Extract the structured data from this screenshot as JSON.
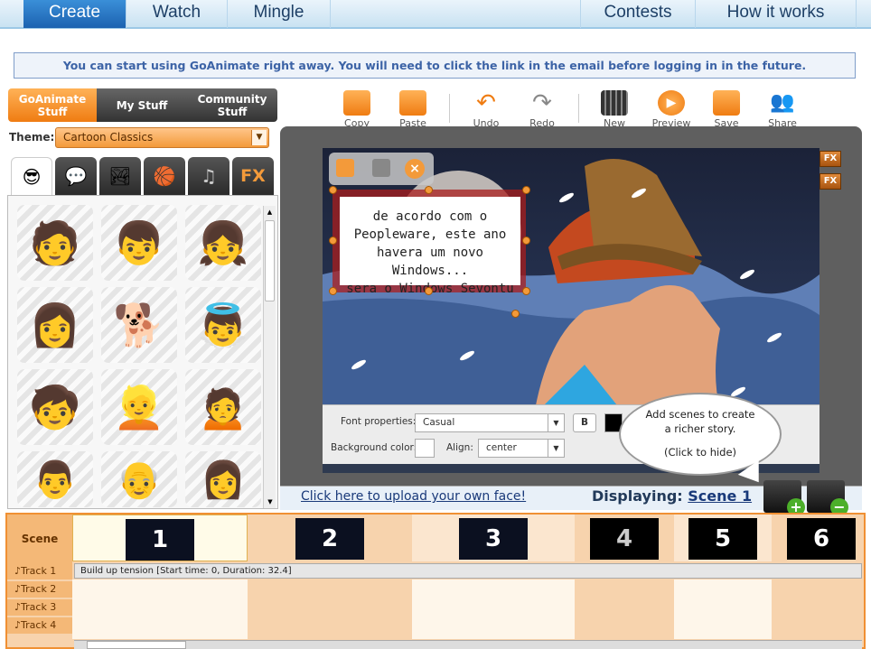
{
  "nav": {
    "create": "Create",
    "watch": "Watch",
    "mingle": "Mingle",
    "contests": "Contests",
    "how_it_works": "How it works"
  },
  "notice": "You can start using GoAnimate right away. You will need to click the link in the email before logging in in the future.",
  "library_tabs": {
    "goanimate_stuff": "GoAnimate Stuff",
    "my_stuff": "My Stuff",
    "community_stuff": "Community Stuff"
  },
  "theme": {
    "label": "Theme:",
    "value": "Cartoon Classics"
  },
  "category_tabs": {
    "fx": "FX"
  },
  "toolbar": {
    "copy": "Copy",
    "paste": "Paste",
    "undo": "Undo",
    "redo": "Redo",
    "new": "New",
    "preview": "Preview",
    "save": "Save",
    "share": "Share"
  },
  "stage": {
    "speech_text_line1": "de acordo com o",
    "speech_text_line2": "Peopleware, este ano",
    "speech_text_line3": "havera um novo Windows...",
    "speech_text_line4": "sera o Windows Sevontu",
    "fx_label": "FX"
  },
  "font_bar": {
    "font_properties_label": "Font properties:",
    "font_value": "Casual",
    "bold_label": "B",
    "background_color_label": "Background color:",
    "align_label": "Align:",
    "align_value": "center"
  },
  "hint_bubble": {
    "line1": "Add scenes to create",
    "line2": "a richer story.",
    "line3": "(Click to hide)"
  },
  "upload_link": "Click here to upload your own face!",
  "displaying": {
    "label": "Displaying:",
    "scene": "Scene 1"
  },
  "timeline": {
    "scene_label": "Scene",
    "scenes": [
      "1",
      "2",
      "3",
      "4",
      "5",
      "6"
    ],
    "tracks": [
      "Track 1",
      "Track 2",
      "Track 3",
      "Track 4"
    ],
    "track1_item": "Build up tension [Start time: 0, Duration: 32.4]"
  },
  "colors": {
    "accent_orange": "#f39a3a",
    "nav_blue": "#1c62b0",
    "stage_gray": "#5f5f5f"
  }
}
